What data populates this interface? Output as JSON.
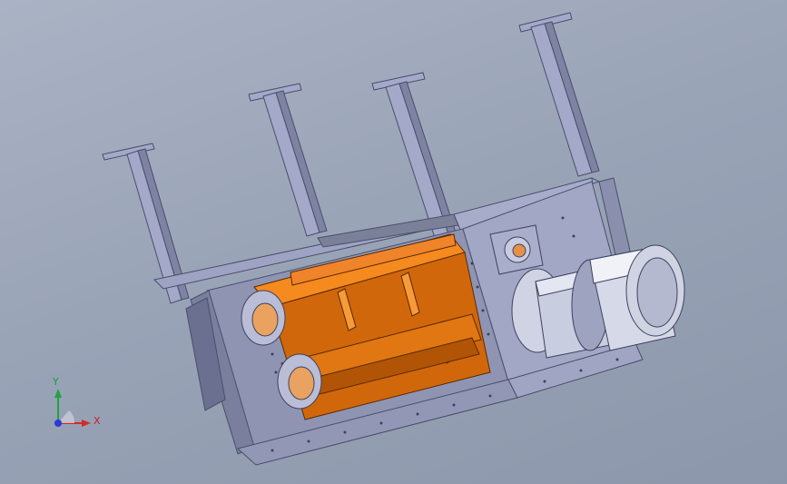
{
  "viewport": {
    "background_top": "#aab3c4",
    "background_bottom": "#8c97ab"
  },
  "model": {
    "frame_color": "#9a9fbf",
    "frame_dark": "#6f7596",
    "rotor_color": "#f07a12",
    "rotor_dark": "#c65c08",
    "motor_color": "#d4d8e6"
  },
  "triad": {
    "x_label": "X",
    "y_label": "Y",
    "x_color": "#d42a2a",
    "y_color": "#1fa33f",
    "z_color": "#2a3ad4"
  }
}
